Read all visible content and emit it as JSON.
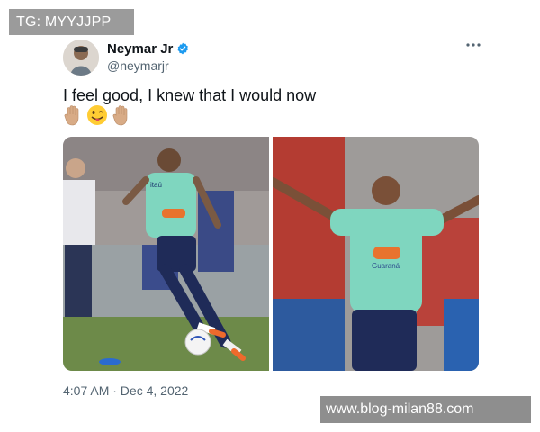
{
  "watermarks": {
    "top": "TG: MYYJJPP",
    "bottom": "www.blog-milan88.com"
  },
  "tweet": {
    "author": {
      "display_name": "Neymar Jr",
      "handle": "@neymarjr",
      "verified": true
    },
    "more_icon": "more-icon",
    "text": "I feel good, I knew that I would now",
    "emojis": [
      "raised-hand-icon",
      "winking-tongue-face-icon",
      "raised-hand-icon"
    ],
    "images": [
      {
        "caption": "",
        "jersey_text": "Itaú"
      },
      {
        "caption": "",
        "jersey_text": "Guaraná"
      }
    ],
    "timestamp": "4:07 AM · Dec 4, 2022"
  },
  "colors": {
    "text": "#0f1419",
    "secondary": "#536471",
    "verified": "#1d9bf0",
    "jersey": "#6fd1b5",
    "watermark": "#9b9b9b"
  }
}
